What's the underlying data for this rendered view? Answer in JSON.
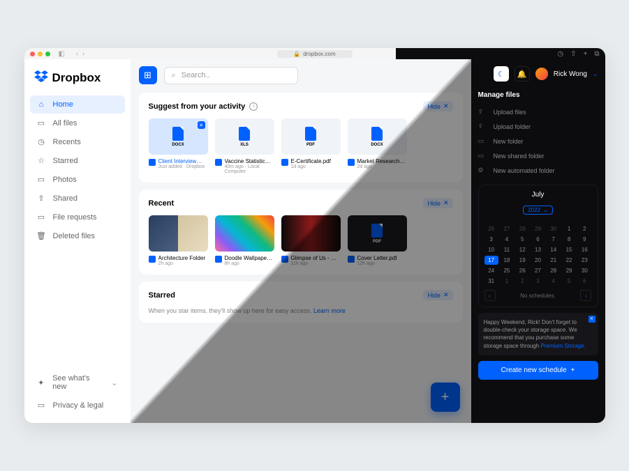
{
  "browser": {
    "url": "dropbox.com"
  },
  "logo": "Dropbox",
  "nav": [
    {
      "icon": "⌂",
      "label": "Home",
      "active": true
    },
    {
      "icon": "▭",
      "label": "All files"
    },
    {
      "icon": "◷",
      "label": "Recents"
    },
    {
      "icon": "☆",
      "label": "Starred"
    },
    {
      "icon": "▭",
      "label": "Photos"
    },
    {
      "icon": "⇪",
      "label": "Shared"
    },
    {
      "icon": "▭",
      "label": "File requests"
    },
    {
      "icon": "🗑",
      "label": "Deleted files"
    }
  ],
  "bottom_nav": [
    {
      "icon": "✦",
      "label": "See what's new"
    },
    {
      "icon": "▭",
      "label": "Privacy & legal"
    }
  ],
  "search_placeholder": "Search..",
  "user": {
    "name": "Rick Wong"
  },
  "suggest": {
    "title": "Suggest from your activity",
    "hide": "Hide",
    "items": [
      {
        "type": "DOCX",
        "title": "Client Interview…",
        "sub": "Just added · Dropbox",
        "selected": true
      },
      {
        "type": "XLS",
        "title": "Vaccine Statistics.xls",
        "sub": "40m ago · Local Computer"
      },
      {
        "type": "PDF",
        "title": "E-Certificate.pdf",
        "sub": "1d ago"
      },
      {
        "type": "DOCX",
        "title": "Market Research…",
        "sub": "2d ago"
      }
    ]
  },
  "recent": {
    "title": "Recent",
    "hide": "Hide",
    "items": [
      {
        "title": "Architecture Folder",
        "sub": "2h ago",
        "thumb": "arch"
      },
      {
        "title": "Doodle Wallpaper.png",
        "sub": "8h ago",
        "thumb": "doodle"
      },
      {
        "title": "Glimpse of Us - …",
        "sub": "11h ago",
        "thumb": "portrait"
      },
      {
        "title": "Cover Letter.pdf",
        "sub": "12h ago",
        "thumb": "pdf"
      }
    ]
  },
  "starred": {
    "title": "Starred",
    "hide": "Hide",
    "text": "When you star items, they'll show up here for easy access. ",
    "link": "Learn more"
  },
  "manage": {
    "title": "Manage files",
    "items": [
      {
        "label": "Upload files"
      },
      {
        "label": "Upload folder"
      },
      {
        "label": "New folder"
      },
      {
        "label": "New shared folder"
      },
      {
        "label": "New automated folder"
      }
    ]
  },
  "calendar": {
    "month": "July",
    "year": "2022",
    "days": [
      "26",
      "27",
      "28",
      "29",
      "30",
      "1",
      "2",
      "3",
      "4",
      "5",
      "6",
      "7",
      "8",
      "9",
      "10",
      "11",
      "12",
      "13",
      "14",
      "15",
      "16",
      "17",
      "18",
      "19",
      "20",
      "21",
      "22",
      "23",
      "24",
      "25",
      "26",
      "27",
      "28",
      "29",
      "30",
      "31",
      "1",
      "2",
      "3",
      "4",
      "5",
      "6"
    ],
    "today_index": 21,
    "dim_start": 5,
    "dim_end": 35,
    "no_schedule": "No schedules."
  },
  "toast": {
    "text": "Happy Weekend, Rick! Don't forget to double-check your storage space. We recommend that you purchase some storage space through ",
    "link": "Premium Storage."
  },
  "cta": "Create new schedule"
}
